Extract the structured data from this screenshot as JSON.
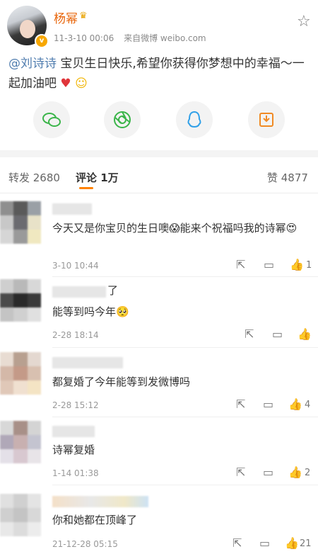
{
  "post": {
    "author": "杨幂",
    "time": "11-3-10 00:06",
    "source": "来自微博 weibo.com",
    "mention": "@刘诗诗",
    "text": " 宝贝生日快乐,希望你获得你梦想中的幸福～一起加油吧",
    "emoji_heart": "♥",
    "emoji_smile": "☺"
  },
  "share_icons": [
    "wechat-icon",
    "moments-icon",
    "qq-icon",
    "save-image-icon"
  ],
  "tabs": {
    "repost": "转发 2680",
    "comments": "评论 1万",
    "likes": "赞 4877"
  },
  "comments": [
    {
      "name_suffix": "",
      "text": "今天又是你宝贝的生日噢😱能来个祝福吗我的诗幂😍",
      "time": "3-10 10:44",
      "likes": "1"
    },
    {
      "name_suffix": "了",
      "text": "能等到吗今年🥺",
      "time": "2-28 18:14",
      "likes": ""
    },
    {
      "name_suffix": "",
      "text": "都复婚了今年能等到发微博吗",
      "time": "2-28 15:12",
      "likes": "4"
    },
    {
      "name_suffix": "",
      "text": "诗幂复婚",
      "time": "1-14 01:38",
      "likes": "2"
    },
    {
      "name_suffix": "",
      "text": "你和她都在顶峰了",
      "time": "21-12-28 05:15",
      "likes": "21"
    }
  ],
  "colors": {
    "author": "#e8650a",
    "mention": "#507daf",
    "accent": "#ff8200"
  }
}
